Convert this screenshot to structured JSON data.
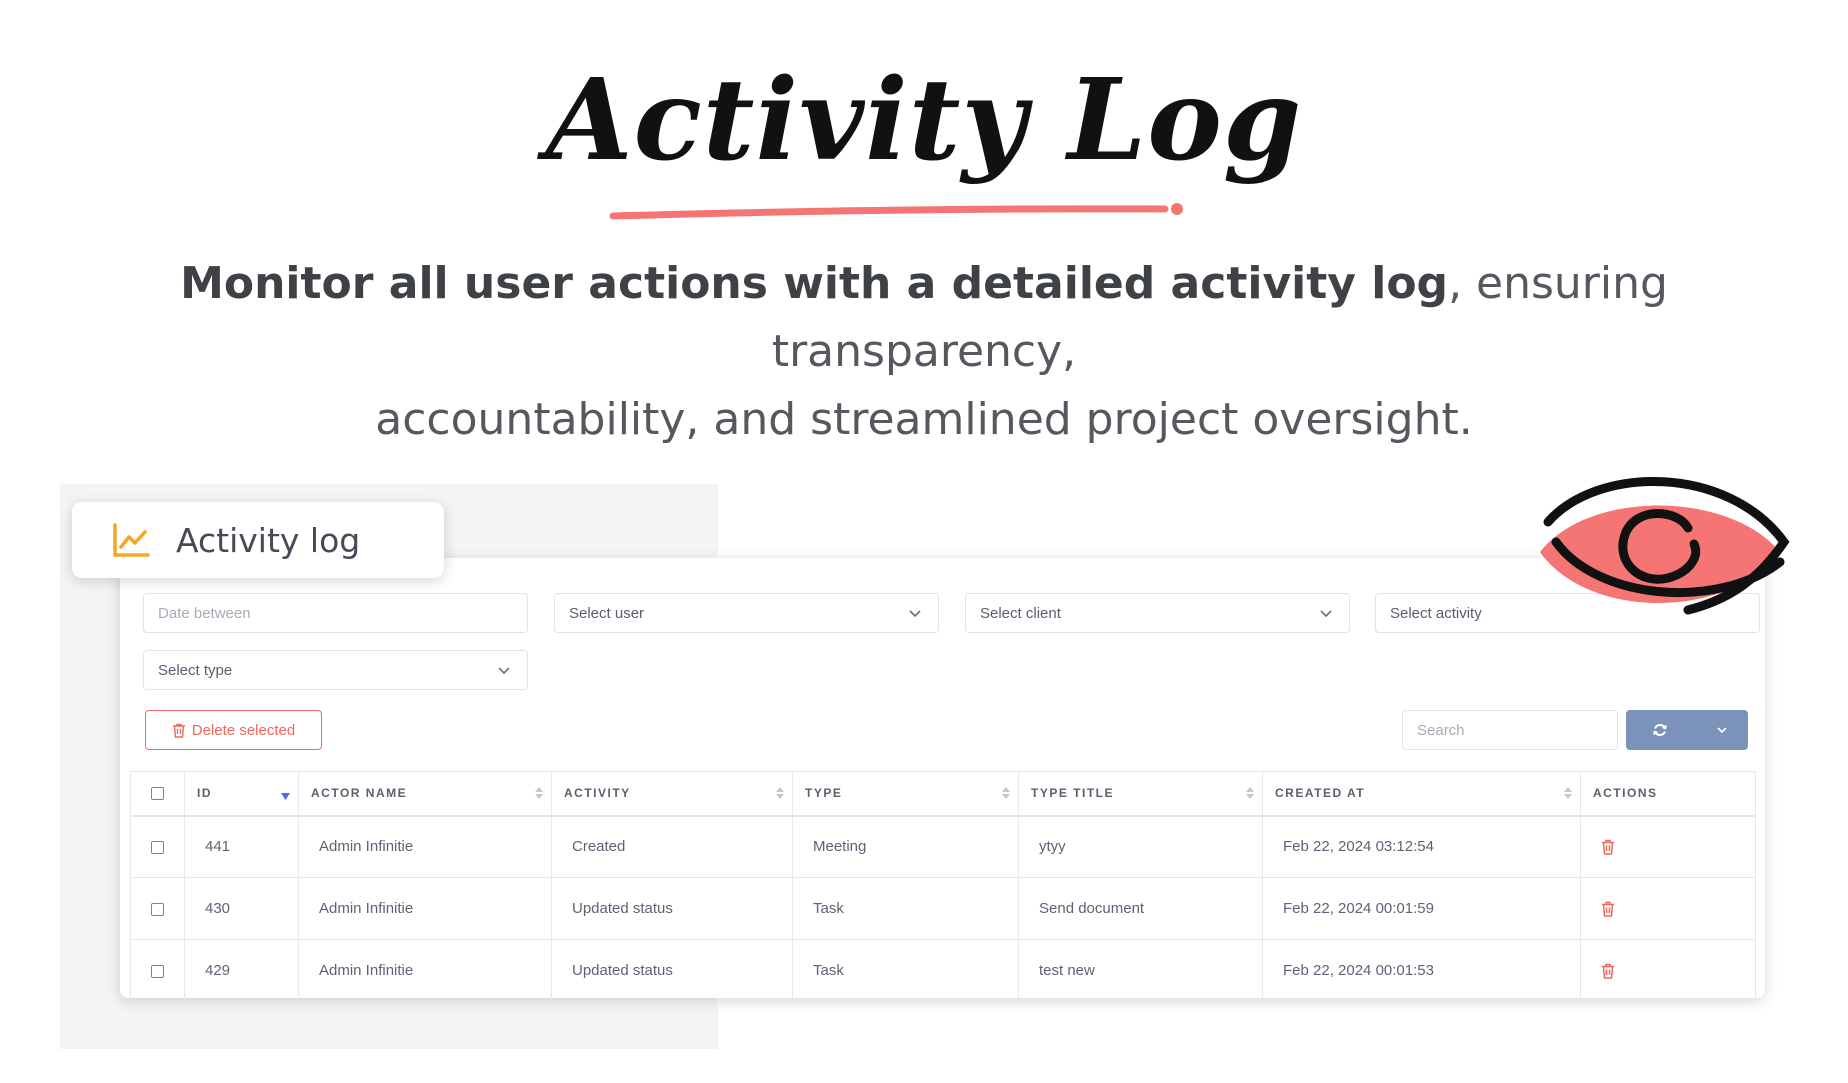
{
  "hero": {
    "title": "Activity Log",
    "subtitle_bold": "Monitor all user actions with a detailed activity log",
    "subtitle_rest_line1": ", ensuring transparency,",
    "subtitle_line2": "accountability, and streamlined project oversight."
  },
  "module": {
    "title": "Activity log",
    "icon": "line-chart-icon"
  },
  "filters": {
    "date_placeholder": "Date between",
    "user": "Select user",
    "client": "Select client",
    "activity": "Select activity",
    "type": "Select type"
  },
  "toolbar": {
    "delete_label": "Delete selected",
    "search_placeholder": "Search",
    "refresh_icon": "refresh-icon"
  },
  "table": {
    "columns": [
      "ID",
      "ACTOR NAME",
      "ACTIVITY",
      "TYPE",
      "TYPE TITLE",
      "CREATED AT",
      "ACTIONS"
    ],
    "rows": [
      {
        "id": "441",
        "actor": "Admin Infinitie",
        "activity": "Created",
        "type": "Meeting",
        "type_title": "ytyy",
        "created_at": "Feb 22, 2024 03:12:54"
      },
      {
        "id": "430",
        "actor": "Admin Infinitie",
        "activity": "Updated status",
        "type": "Task",
        "type_title": "Send document",
        "created_at": "Feb 22, 2024 00:01:59"
      },
      {
        "id": "429",
        "actor": "Admin Infinitie",
        "activity": "Updated status",
        "type": "Task",
        "type_title": "test new",
        "created_at": "Feb 22, 2024 00:01:53"
      }
    ]
  },
  "colors": {
    "accent_red": "#f0685c",
    "eye_fill": "#f47574",
    "refresh_button": "#7b93bb",
    "chart_icon": "#f5a623"
  }
}
